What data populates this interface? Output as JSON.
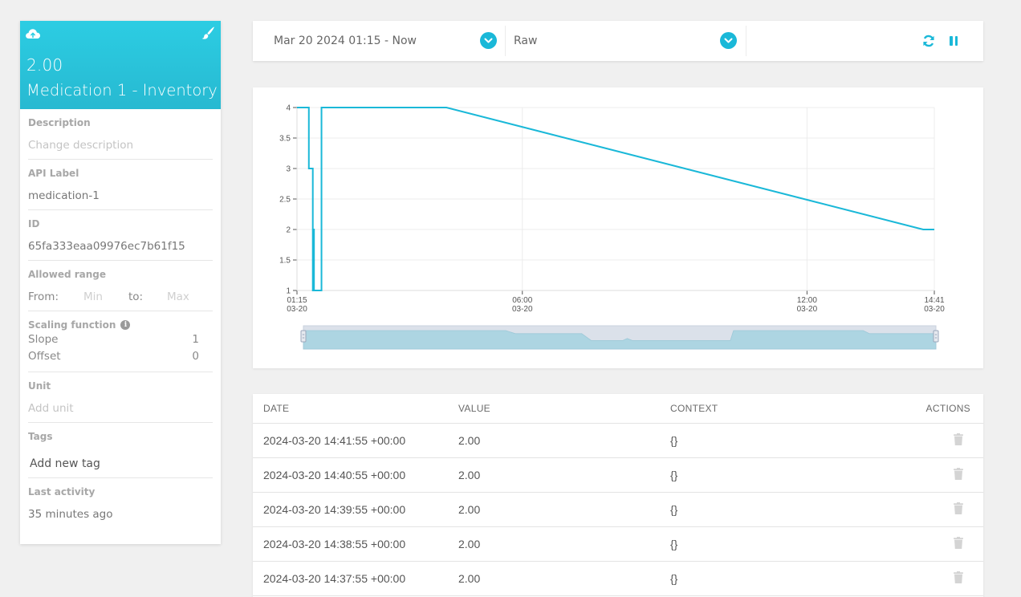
{
  "variable": {
    "last_value": "2.00",
    "name": "Medication 1 - Inventory",
    "header_icons": [
      "cloud-upload-icon",
      "paintbrush-icon"
    ],
    "accent_color": "#2ccde3"
  },
  "details": {
    "description": {
      "label": "Description",
      "placeholder": "Change description"
    },
    "api_label": {
      "label": "API Label",
      "value": "medication-1"
    },
    "id": {
      "label": "ID",
      "value": "65fa333eaa09976ec7b61f15"
    },
    "allowed_range": {
      "label": "Allowed range",
      "from_label": "From:",
      "min_placeholder": "Min",
      "to_label": "to:",
      "max_placeholder": "Max"
    },
    "scaling": {
      "label": "Scaling function",
      "info_icon": "info-icon",
      "slope_label": "Slope",
      "slope_value": "1",
      "offset_label": "Offset",
      "offset_value": "0"
    },
    "unit": {
      "label": "Unit",
      "placeholder": "Add unit"
    },
    "tags": {
      "label": "Tags",
      "add_label": "Add new tag"
    },
    "last_activity": {
      "label": "Last activity",
      "value": "35 minutes ago"
    }
  },
  "toolbar": {
    "date_range": "Mar 20 2024 01:15 - Now",
    "aggregation": "Raw",
    "refresh_icon": "refresh-icon",
    "pause_icon": "pause-icon",
    "accent_color": "#1ab8d8"
  },
  "chart_data": {
    "type": "line",
    "title": "",
    "xlabel": "",
    "ylabel": "",
    "x_unit": "minutes since 00:00 on 03-20",
    "xlim": [
      75,
      881
    ],
    "ylim": [
      1,
      4
    ],
    "y_ticks": [
      1,
      1.5,
      2,
      2.5,
      3,
      3.5,
      4
    ],
    "y_tick_labels": [
      "1",
      "1.5",
      "2",
      "2.5",
      "3",
      "3.5",
      "4"
    ],
    "x_ticks": [
      75,
      360,
      720,
      881
    ],
    "x_tick_labels": [
      [
        "01:15",
        "03-20"
      ],
      [
        "06:00",
        "03-20"
      ],
      [
        "12:00",
        "03-20"
      ],
      [
        "14:41",
        "03-20"
      ]
    ],
    "grid": true,
    "legend": "none",
    "series": [
      {
        "name": "Medication 1 - Inventory",
        "color": "#1ab8d8",
        "step": true,
        "points": [
          [
            75,
            4
          ],
          [
            89,
            4
          ],
          [
            90,
            3
          ],
          [
            94,
            3
          ],
          [
            95,
            1
          ],
          [
            96,
            2
          ],
          [
            96.5,
            1
          ],
          [
            105,
            1
          ],
          [
            106,
            4
          ],
          [
            264,
            4
          ],
          [
            867,
            2
          ],
          [
            881,
            2
          ]
        ]
      }
    ],
    "navigator": {
      "fill_color": "#add5e2",
      "background_color": "#dbe1ea",
      "range_selected": [
        75,
        881
      ]
    }
  },
  "table": {
    "columns": [
      "DATE",
      "VALUE",
      "CONTEXT",
      "ACTIONS"
    ],
    "rows": [
      {
        "date": "2024-03-20 14:41:55 +00:00",
        "value": "2.00",
        "context": "{}"
      },
      {
        "date": "2024-03-20 14:40:55 +00:00",
        "value": "2.00",
        "context": "{}"
      },
      {
        "date": "2024-03-20 14:39:55 +00:00",
        "value": "2.00",
        "context": "{}"
      },
      {
        "date": "2024-03-20 14:38:55 +00:00",
        "value": "2.00",
        "context": "{}"
      },
      {
        "date": "2024-03-20 14:37:55 +00:00",
        "value": "2.00",
        "context": "{}"
      }
    ],
    "row_action_icon": "trash-icon"
  }
}
